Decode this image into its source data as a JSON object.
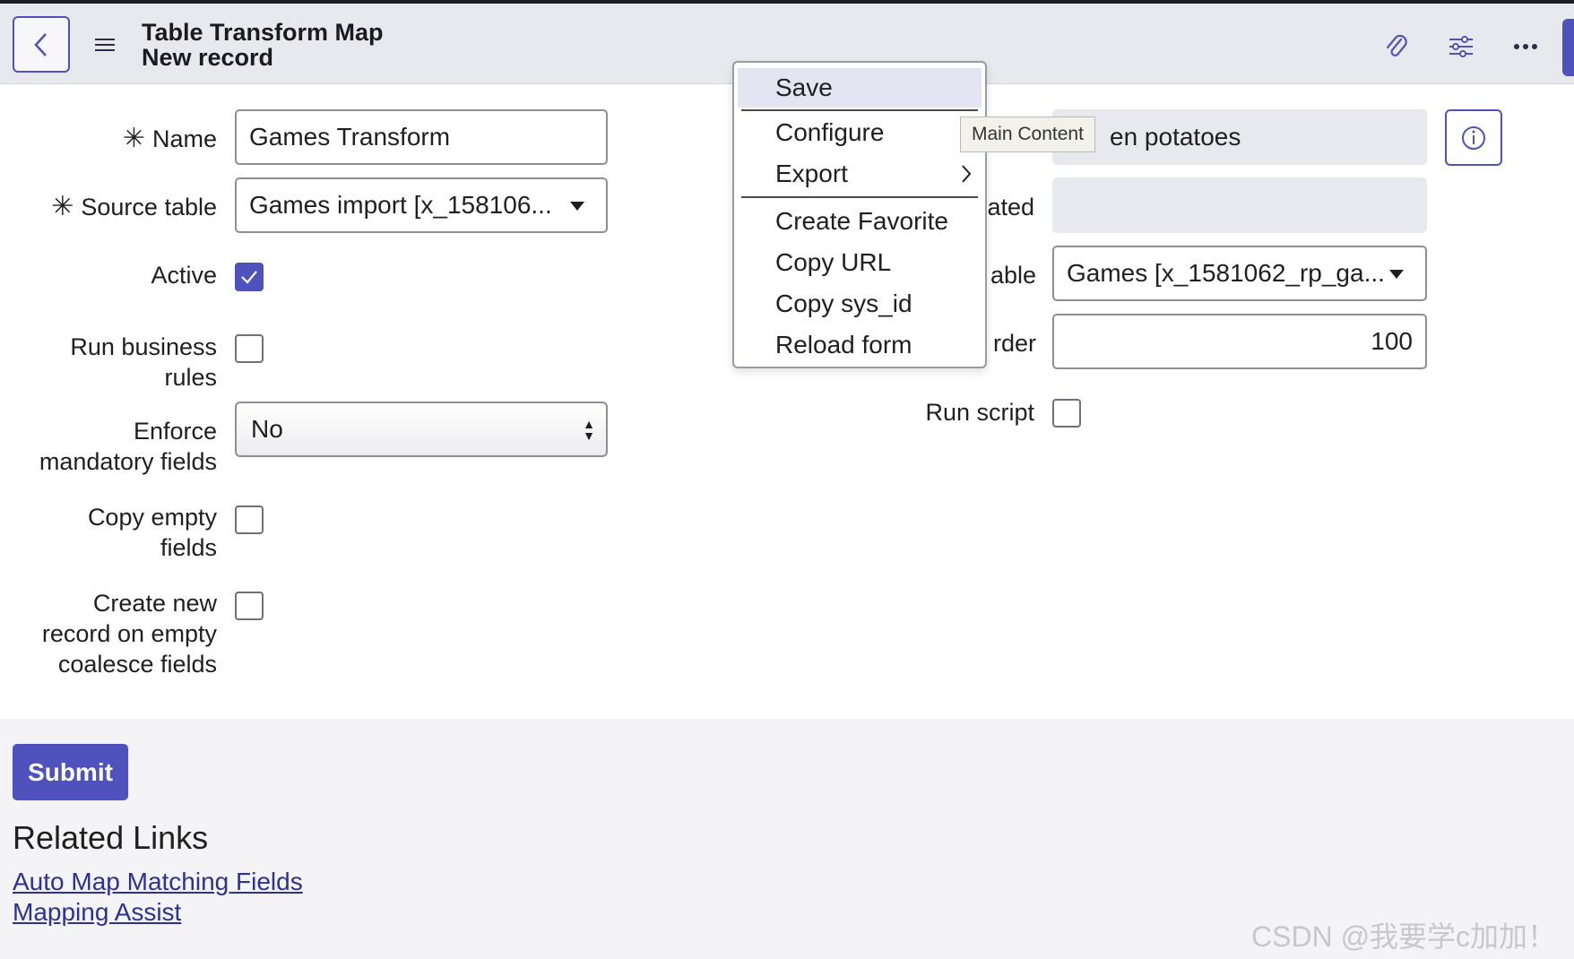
{
  "header": {
    "title": "Table Transform Map",
    "subtitle": "New record",
    "icons": [
      "back-icon",
      "menu-icon",
      "paperclip-icon",
      "settings-sliders-icon",
      "more-icon"
    ]
  },
  "form": {
    "name": {
      "label": "Name",
      "value": "Games Transform",
      "required": true
    },
    "source_table": {
      "label": "Source table",
      "value": "Games import [x_158106...",
      "required": true
    },
    "active": {
      "label": "Active",
      "checked": true
    },
    "run_business_rules": {
      "label_line1": "Run business",
      "label_line2": "rules",
      "checked": false
    },
    "enforce_mandatory": {
      "label_line1": "Enforce",
      "label_line2": "mandatory fields",
      "value": "No"
    },
    "copy_empty": {
      "label_line1": "Copy empty",
      "label_line2": "fields",
      "checked": false
    },
    "create_new_record": {
      "label_line1": "Create new",
      "label_line2": "record on empty",
      "label_line3": "coalesce fields",
      "checked": false
    },
    "right_readonly_1": {
      "value": "en potatoes"
    },
    "right_label_2": "ated",
    "right_label_3": "able",
    "target_table": {
      "value": "Games [x_1581062_rp_ga..."
    },
    "right_label_4": "rder",
    "order": {
      "value": "100"
    },
    "run_script": {
      "label": "Run script",
      "checked": false
    }
  },
  "context_menu": {
    "items": [
      "Save",
      "Configure",
      "Export",
      "Create Favorite",
      "Copy URL",
      "Copy sys_id",
      "Reload form"
    ]
  },
  "tooltip": "Main Content",
  "footer": {
    "submit_label": "Submit",
    "related_title": "Related Links",
    "links": [
      "Auto Map Matching Fields",
      "Mapping Assist"
    ]
  },
  "watermark": "CSDN @我要学c加加！",
  "colors": {
    "accent": "#4f52bd",
    "link": "#2e3192"
  }
}
